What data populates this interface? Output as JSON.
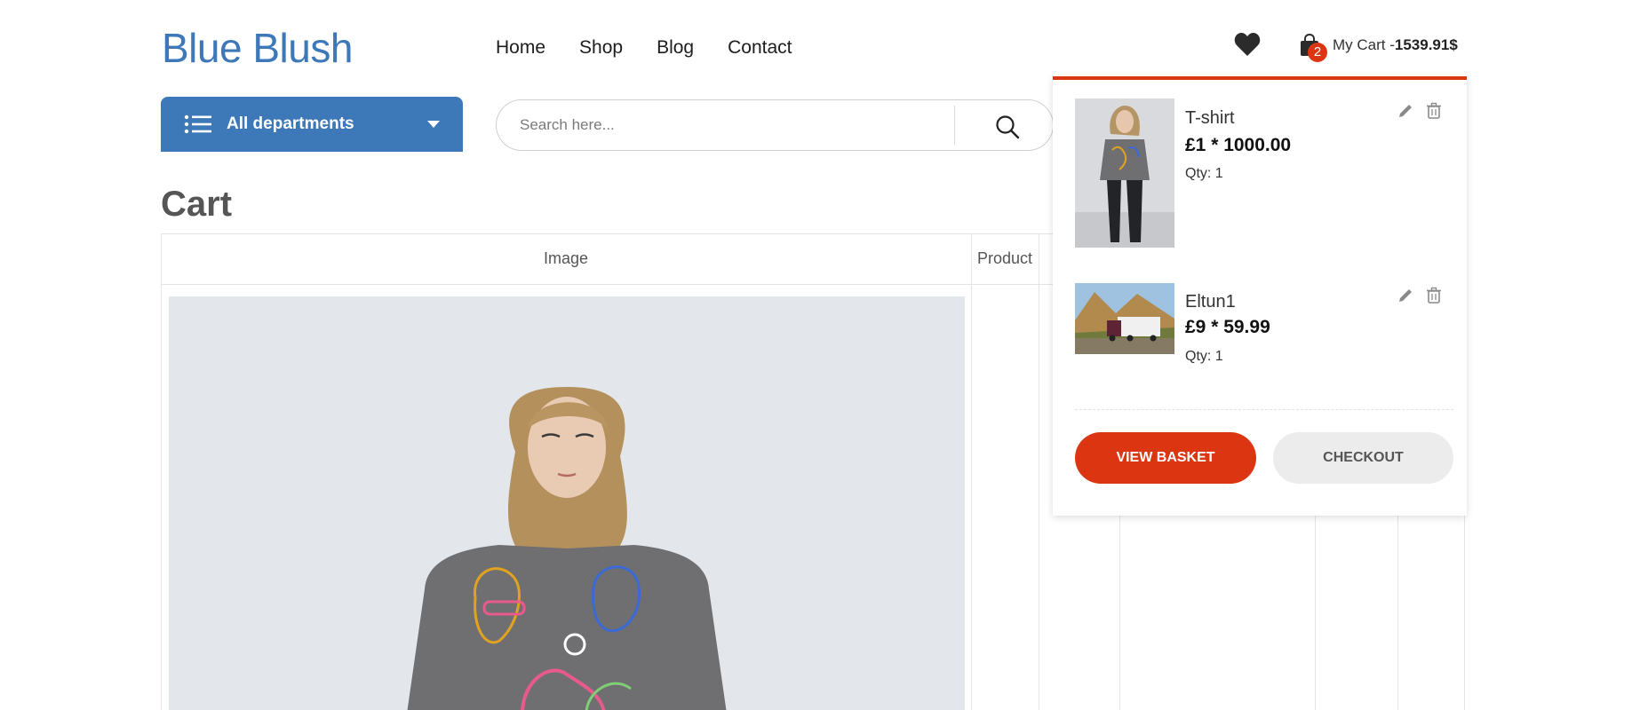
{
  "brand": {
    "name": "Blue Blush",
    "color": "#3d78b8"
  },
  "nav": {
    "items": [
      {
        "label": "Home"
      },
      {
        "label": "Shop"
      },
      {
        "label": "Blog"
      },
      {
        "label": "Contact"
      }
    ]
  },
  "header": {
    "wishlist_icon": "heart-icon",
    "cart": {
      "icon": "shopping-bag-icon",
      "count": "2",
      "label": "My Cart -",
      "total": "1539.91$"
    }
  },
  "departments": {
    "label": "All departments",
    "icon": "menu-list-icon"
  },
  "search": {
    "placeholder": "Search here...",
    "icon": "search-icon"
  },
  "page": {
    "title": "Cart"
  },
  "table": {
    "columns": [
      "Image",
      "Product"
    ]
  },
  "mini_cart": {
    "accent": "#dc3512",
    "items": [
      {
        "name": "T-shirt",
        "price": "£1 * 1000.00",
        "qty": "Qty: 1",
        "edit_icon": "pencil-icon",
        "delete_icon": "trash-icon"
      },
      {
        "name": "Eltun1",
        "price": "£9 * 59.99",
        "qty": "Qty: 1",
        "edit_icon": "pencil-icon",
        "delete_icon": "trash-icon"
      }
    ],
    "view_basket": "VIEW BASKET",
    "checkout": "CHECKOUT"
  }
}
